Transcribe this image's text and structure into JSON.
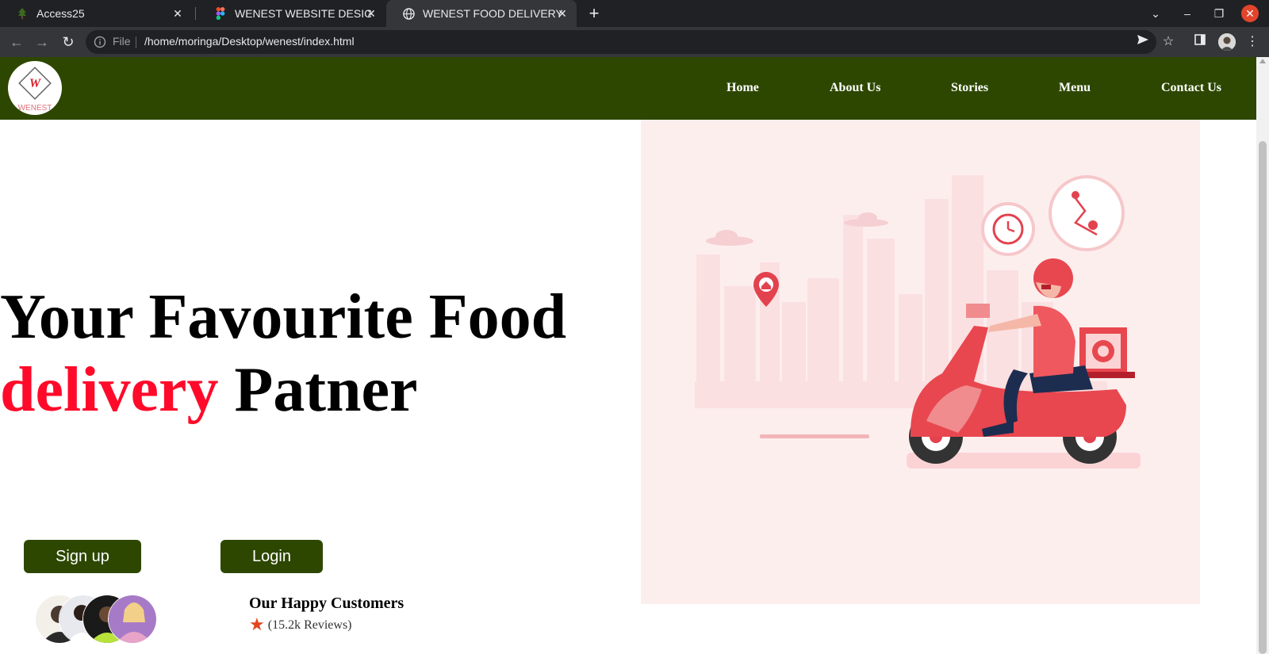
{
  "browser": {
    "tabs": [
      {
        "title": "Access25",
        "icon": "tree-icon",
        "active": false
      },
      {
        "title": "WENEST WEBSITE DESIGN",
        "icon": "figma-icon",
        "active": false
      },
      {
        "title": "WENEST FOOD DELIVERY",
        "icon": "globe-icon",
        "active": true
      }
    ],
    "new_tab_label": "+",
    "omnibox": {
      "scheme_label": "File",
      "url": "/home/moringa/Desktop/wenest/index.html"
    }
  },
  "site": {
    "logo_text": "WENEST",
    "nav": [
      "Home",
      "About Us",
      "Stories",
      "Menu",
      "Contact Us"
    ],
    "hero": {
      "line1": "Your Favourite Food",
      "accent_word": "delivery",
      "line2_rest": " Patner"
    },
    "buttons": {
      "signup": "Sign up",
      "login": "Login"
    },
    "customers": {
      "title": "Our Happy Customers",
      "reviews": "(15.2k Reviews)"
    }
  },
  "colors": {
    "brand_green": "#2d4700",
    "accent_red": "#ff0a2a",
    "hero_bg": "#fdeeee"
  }
}
